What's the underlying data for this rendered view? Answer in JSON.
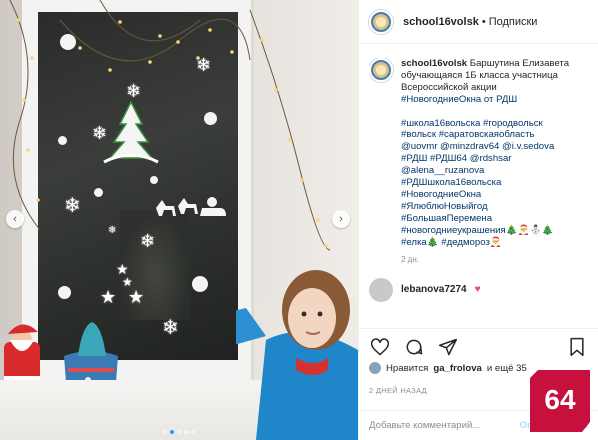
{
  "post": {
    "username": "school16volsk",
    "header_separator": "•",
    "follow_label": "Подписки",
    "caption": {
      "username": "school16volsk",
      "lines": [
        "Баршутина Елизавета",
        "обучающаяся 1Б класса участница",
        "Всероссийской акции",
        "#НовогодниеОкна от РДШ"
      ],
      "hashtag_lines": [
        "#школа16вольска #городвольск",
        "#вольск #саратовскаяобласть",
        "@uovmr @minzdrav64 @i.v.sedova",
        "#РДШ #РДШ64 @rdshsar",
        "@alena__ruzanova",
        "#РДШшкола16вольска",
        "#НовогодниеОкна",
        "#ЯлюблюНовыйгод",
        "#БольшаяПеремена",
        "#новогодниеукрашения🎄🎅⛄🎄",
        "#елка🎄 #дедмороз🎅"
      ],
      "date": "2 дн."
    },
    "next_comment": {
      "username": "lebanova7274"
    },
    "likes": {
      "prefix": "Нравится",
      "user": "ga_frolova",
      "suffix": "и ещё 35"
    },
    "date_label": "2 ДНЕЙ НАЗАД",
    "add_comment_placeholder": "Добавьте комментарий...",
    "publish_label": "Опубликовать"
  },
  "icons": {
    "like": "heart-icon",
    "comment": "comment-icon",
    "share": "share-icon",
    "save": "bookmark-icon",
    "carousel_prev": "chevron-left-icon",
    "carousel_next": "chevron-right-icon"
  },
  "carousel": {
    "count": 5,
    "active_index": 1
  },
  "badge": {
    "text": "64",
    "color": "#c8103e"
  },
  "colors": {
    "link": "#00376b",
    "muted": "#8e8e8e",
    "publish": "#b2dffc"
  }
}
